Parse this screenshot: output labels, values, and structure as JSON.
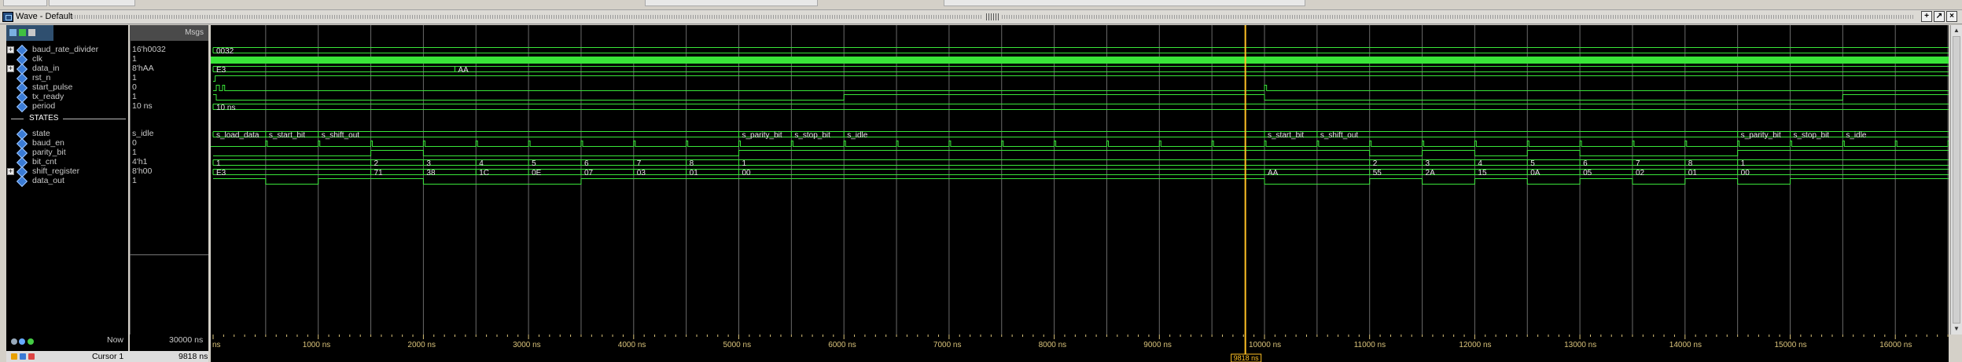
{
  "window": {
    "title": "Wave - Default",
    "buttons": [
      "+",
      "↗",
      "×"
    ]
  },
  "columns": {
    "msgs": "Msgs"
  },
  "signals": [
    {
      "name": "baud_rate_divider",
      "value": "16'h0032",
      "expand": "+"
    },
    {
      "name": "clk",
      "value": "1",
      "expand": ""
    },
    {
      "name": "data_in",
      "value": "8'hAA",
      "expand": "+"
    },
    {
      "name": "rst_n",
      "value": "1",
      "expand": ""
    },
    {
      "name": "start_pulse",
      "value": "0",
      "expand": ""
    },
    {
      "name": "tx_ready",
      "value": "1",
      "expand": ""
    },
    {
      "name": "period",
      "value": "10 ns",
      "expand": ""
    }
  ],
  "divider": "STATES",
  "signals2": [
    {
      "name": "state",
      "value": "s_idle",
      "expand": ""
    },
    {
      "name": "baud_en",
      "value": "0",
      "expand": ""
    },
    {
      "name": "parity_bit",
      "value": "1",
      "expand": ""
    },
    {
      "name": "bit_cnt",
      "value": "4'h1",
      "expand": ""
    },
    {
      "name": "shift_register",
      "value": "8'h00",
      "expand": "+"
    },
    {
      "name": "data_out",
      "value": "1",
      "expand": ""
    }
  ],
  "footer": {
    "now_label": "Now",
    "now_value": "30000 ns",
    "cursor_label": "Cursor 1",
    "cursor_value": "9818 ns",
    "cursor_marker": "9818 ns"
  },
  "wave": {
    "t_start_ns": 0,
    "t_end_ns": 16500,
    "cursor_ns": 9818,
    "colors": {
      "wave": "#39e639",
      "grid": "#6a6a6a",
      "cursor": "#ffc125",
      "text": "#e6e6e6",
      "ticks": "#d9c27a"
    },
    "tick_labels": [
      "ns",
      "1000 ns",
      "2000 ns",
      "3000 ns",
      "4000 ns",
      "5000 ns",
      "6000 ns",
      "7000 ns",
      "8000 ns",
      "9000 ns",
      "10000 ns",
      "11000 ns",
      "12000 ns",
      "13000 ns",
      "14000 ns",
      "15000 ns",
      "16000 ns"
    ],
    "buses": {
      "baud_rate_divider": [
        [
          0,
          "0032"
        ]
      ],
      "data_in": [
        [
          0,
          "E3"
        ],
        [
          2300,
          "AA"
        ]
      ],
      "period": [
        [
          0,
          "10 ns"
        ]
      ],
      "state": [
        [
          0,
          "s_load_data"
        ],
        [
          500,
          "s_start_bit"
        ],
        [
          1000,
          "s_shift_out"
        ],
        [
          5000,
          "s_parity_bit"
        ],
        [
          5500,
          "s_stop_bit"
        ],
        [
          6000,
          "s_idle"
        ],
        [
          10000,
          "s_start_bit"
        ],
        [
          10500,
          "s_shift_out"
        ],
        [
          14500,
          "s_parity_bit"
        ],
        [
          15000,
          "s_stop_bit"
        ],
        [
          15500,
          "s_idle"
        ]
      ],
      "bit_cnt": [
        [
          0,
          "1"
        ],
        [
          1500,
          "2"
        ],
        [
          2000,
          "3"
        ],
        [
          2500,
          "4"
        ],
        [
          3000,
          "5"
        ],
        [
          3500,
          "6"
        ],
        [
          4000,
          "7"
        ],
        [
          4500,
          "8"
        ],
        [
          5000,
          "1"
        ],
        [
          11000,
          "2"
        ],
        [
          11500,
          "3"
        ],
        [
          12000,
          "4"
        ],
        [
          12500,
          "5"
        ],
        [
          13000,
          "6"
        ],
        [
          13500,
          "7"
        ],
        [
          14000,
          "8"
        ],
        [
          14500,
          "1"
        ]
      ],
      "shift_register": [
        [
          0,
          "E3"
        ],
        [
          1500,
          "71"
        ],
        [
          2000,
          "38"
        ],
        [
          2500,
          "1C"
        ],
        [
          3000,
          "0E"
        ],
        [
          3500,
          "07"
        ],
        [
          4000,
          "03"
        ],
        [
          4500,
          "01"
        ],
        [
          5000,
          "00"
        ],
        [
          10000,
          "AA"
        ],
        [
          11000,
          "55"
        ],
        [
          11500,
          "2A"
        ],
        [
          12000,
          "15"
        ],
        [
          12500,
          "0A"
        ],
        [
          13000,
          "05"
        ],
        [
          13500,
          "02"
        ],
        [
          14000,
          "01"
        ],
        [
          14500,
          "00"
        ]
      ]
    },
    "bits": {
      "rst_n": [
        [
          0,
          0
        ],
        [
          20,
          1
        ]
      ],
      "start_pulse": [
        [
          0,
          0
        ],
        [
          30,
          1
        ],
        [
          60,
          0
        ],
        [
          90,
          1
        ],
        [
          110,
          0
        ],
        [
          10000,
          1
        ],
        [
          10020,
          0
        ]
      ],
      "tx_ready": [
        [
          0,
          1
        ],
        [
          30,
          0
        ],
        [
          6000,
          1
        ],
        [
          10000,
          0
        ],
        [
          15500,
          1
        ]
      ],
      "parity_bit": [
        [
          0,
          0
        ],
        [
          1500,
          1
        ],
        [
          2000,
          0
        ],
        [
          5000,
          1
        ],
        [
          11000,
          0
        ],
        [
          11500,
          1
        ],
        [
          12000,
          0
        ],
        [
          12500,
          1
        ],
        [
          13000,
          0
        ],
        [
          14500,
          1
        ]
      ],
      "data_out": [
        [
          0,
          1
        ],
        [
          500,
          0
        ],
        [
          1000,
          1
        ],
        [
          2000,
          0
        ],
        [
          3500,
          1
        ],
        [
          10000,
          0
        ],
        [
          11000,
          1
        ],
        [
          11500,
          0
        ],
        [
          12000,
          1
        ],
        [
          12500,
          0
        ],
        [
          13000,
          1
        ],
        [
          13500,
          0
        ],
        [
          14000,
          1
        ],
        [
          14500,
          0
        ],
        [
          15000,
          1
        ]
      ]
    },
    "baud_pulse_period_ns": 500
  }
}
